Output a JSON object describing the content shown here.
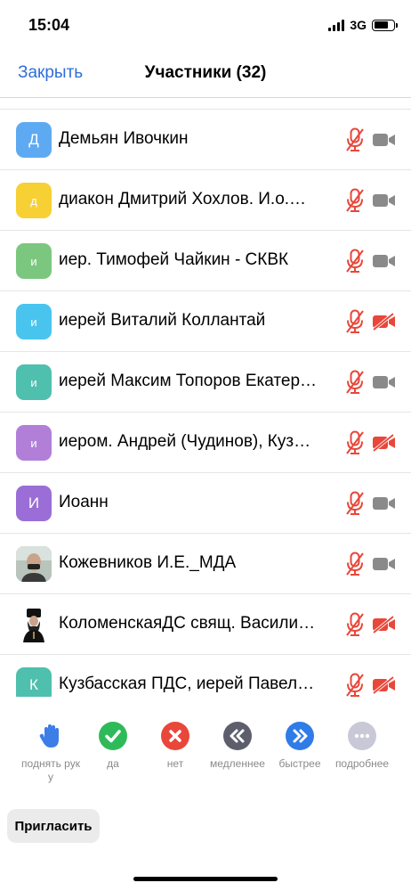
{
  "status_bar": {
    "time": "15:04",
    "network": "3G"
  },
  "nav": {
    "close_label": "Закрыть",
    "title": "Участники (32)"
  },
  "participants": [
    {
      "initial": "Д",
      "name": "Демьян Ивочкин",
      "color": "#5eaaf2",
      "video_off": false
    },
    {
      "initial": "д",
      "name": "диакон Дмитрий Хохлов. И.о.…",
      "color": "#f7d034",
      "video_off": false
    },
    {
      "initial": "и",
      "name": "иер. Тимофей Чайкин - СКВК",
      "color": "#7cc77f",
      "video_off": false
    },
    {
      "initial": "и",
      "name": "иерей Виталий Коллантай",
      "color": "#49c4ef",
      "video_off": true
    },
    {
      "initial": "и",
      "name": "иерей Максим Топоров Екатер…",
      "color": "#4fbfae",
      "video_off": false
    },
    {
      "initial": "и",
      "name": "иером. Андрей (Чудинов), Куз…",
      "color": "#b27fd8",
      "video_off": true
    },
    {
      "initial": "И",
      "name": "Иоанн",
      "color": "#9a6ed6",
      "video_off": false
    },
    {
      "initial": "",
      "name": "Кожевников И.Е._МДА",
      "color": "#8fa6a0",
      "video_off": false
    },
    {
      "initial": "",
      "name": "КоломенскаяДС свящ. Васили…",
      "color": "#ffffff",
      "video_off": true
    },
    {
      "initial": "К",
      "name": "Кузбасская ПДС, иерей Павел…",
      "color": "#4fbfae",
      "video_off": true
    }
  ],
  "reactions": [
    {
      "label": "поднять руку",
      "icon": "raise-hand-icon",
      "color": "#3d7de8"
    },
    {
      "label": "да",
      "icon": "check-icon",
      "color": "#2fba5a"
    },
    {
      "label": "нет",
      "icon": "x-icon",
      "color": "#e8473a"
    },
    {
      "label": "медленнее",
      "icon": "rewind-icon",
      "color": "#5c5f6b"
    },
    {
      "label": "быстрее",
      "icon": "fast-forward-icon",
      "color": "#2f7be8"
    },
    {
      "label": "подробнее",
      "icon": "more-icon",
      "color": "#c8c8d6"
    }
  ],
  "invite": {
    "label": "Пригласить"
  },
  "colors": {
    "accent": "#2e6fd8",
    "muted_red": "#e8473a",
    "camera_gray": "#8a8a8a"
  }
}
